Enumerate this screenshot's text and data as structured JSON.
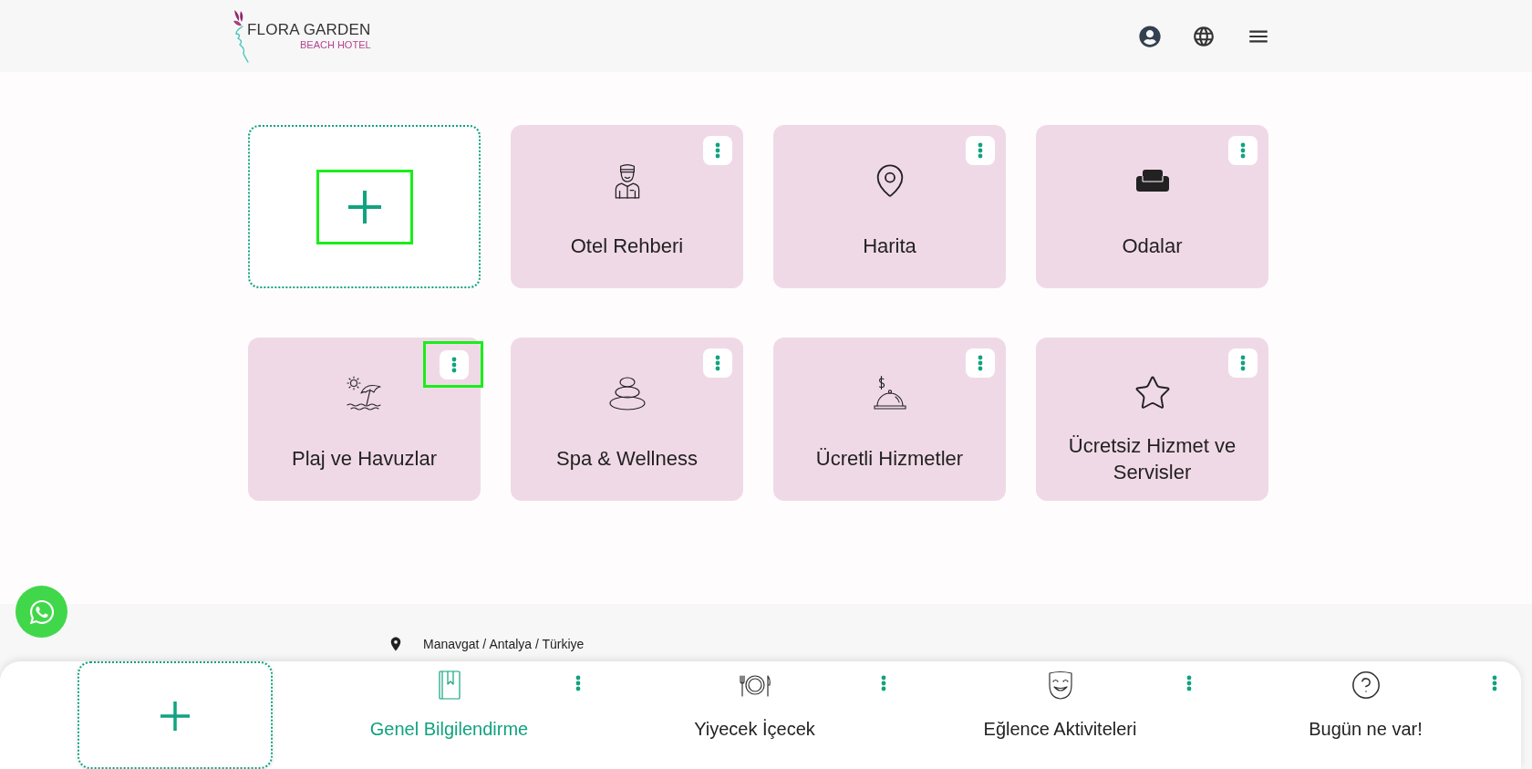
{
  "header": {
    "logo": {
      "title": "FLORA GARDEN",
      "subtitle": "BEACH HOTEL"
    }
  },
  "add_tile": {
    "highlighted": true
  },
  "categories": [
    {
      "label": "Otel Rehberi",
      "menu_highlighted": false
    },
    {
      "label": "Harita",
      "menu_highlighted": false
    },
    {
      "label": "Odalar",
      "menu_highlighted": false
    },
    {
      "label": "Plaj ve Havuzlar",
      "menu_highlighted": true
    },
    {
      "label": "Spa & Wellness",
      "menu_highlighted": false
    },
    {
      "label": "Ücretli Hizmetler",
      "menu_highlighted": false
    },
    {
      "label": "Ücretsiz Hizmet ve Servisler",
      "menu_highlighted": false
    }
  ],
  "footer": {
    "location": "Manavgat / Antalya / Türkiye"
  },
  "bottom_nav": {
    "items": [
      {
        "label": "Genel Bilgilendirme",
        "selected": true
      },
      {
        "label": "Yiyecek İçecek",
        "selected": false
      },
      {
        "label": "Eğlence Aktiviteleri",
        "selected": false
      },
      {
        "label": "Bugün ne var!",
        "selected": false
      }
    ]
  }
}
